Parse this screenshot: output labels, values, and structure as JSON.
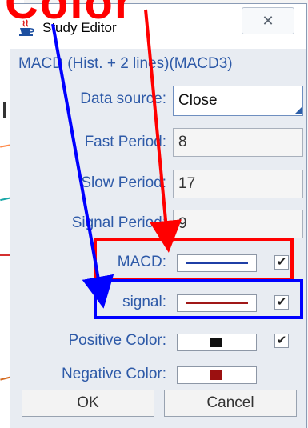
{
  "banner": {
    "text": "Color"
  },
  "window": {
    "title": "Study Editor",
    "close_icon": "close-icon",
    "app_icon": "java-cup-icon"
  },
  "study": {
    "header": "MACD (Hist. + 2 lines)(MACD3)"
  },
  "fields": {
    "data_source": {
      "label": "Data source:",
      "value": "Close"
    },
    "fast_period": {
      "label": "Fast Period:",
      "value": "8"
    },
    "slow_period": {
      "label": "Slow Period:",
      "value": "17"
    },
    "signal_period": {
      "label": "Signal Period:",
      "value": "9"
    }
  },
  "lines": {
    "macd": {
      "label": "MACD:",
      "color": "#1f3fa6",
      "checked": true,
      "check_glyph": "✔"
    },
    "signal": {
      "label": "signal:",
      "color": "#a01818",
      "checked": true,
      "check_glyph": "✔"
    },
    "positive": {
      "label": "Positive Color:",
      "color": "#111111",
      "checked": true,
      "check_glyph": "✔"
    },
    "negative": {
      "label": "Negative Color:",
      "color": "#9b1010"
    }
  },
  "buttons": {
    "ok": "OK",
    "cancel": "Cancel"
  },
  "annotations": {
    "red": "#ff0000",
    "blue": "#0000ff"
  }
}
